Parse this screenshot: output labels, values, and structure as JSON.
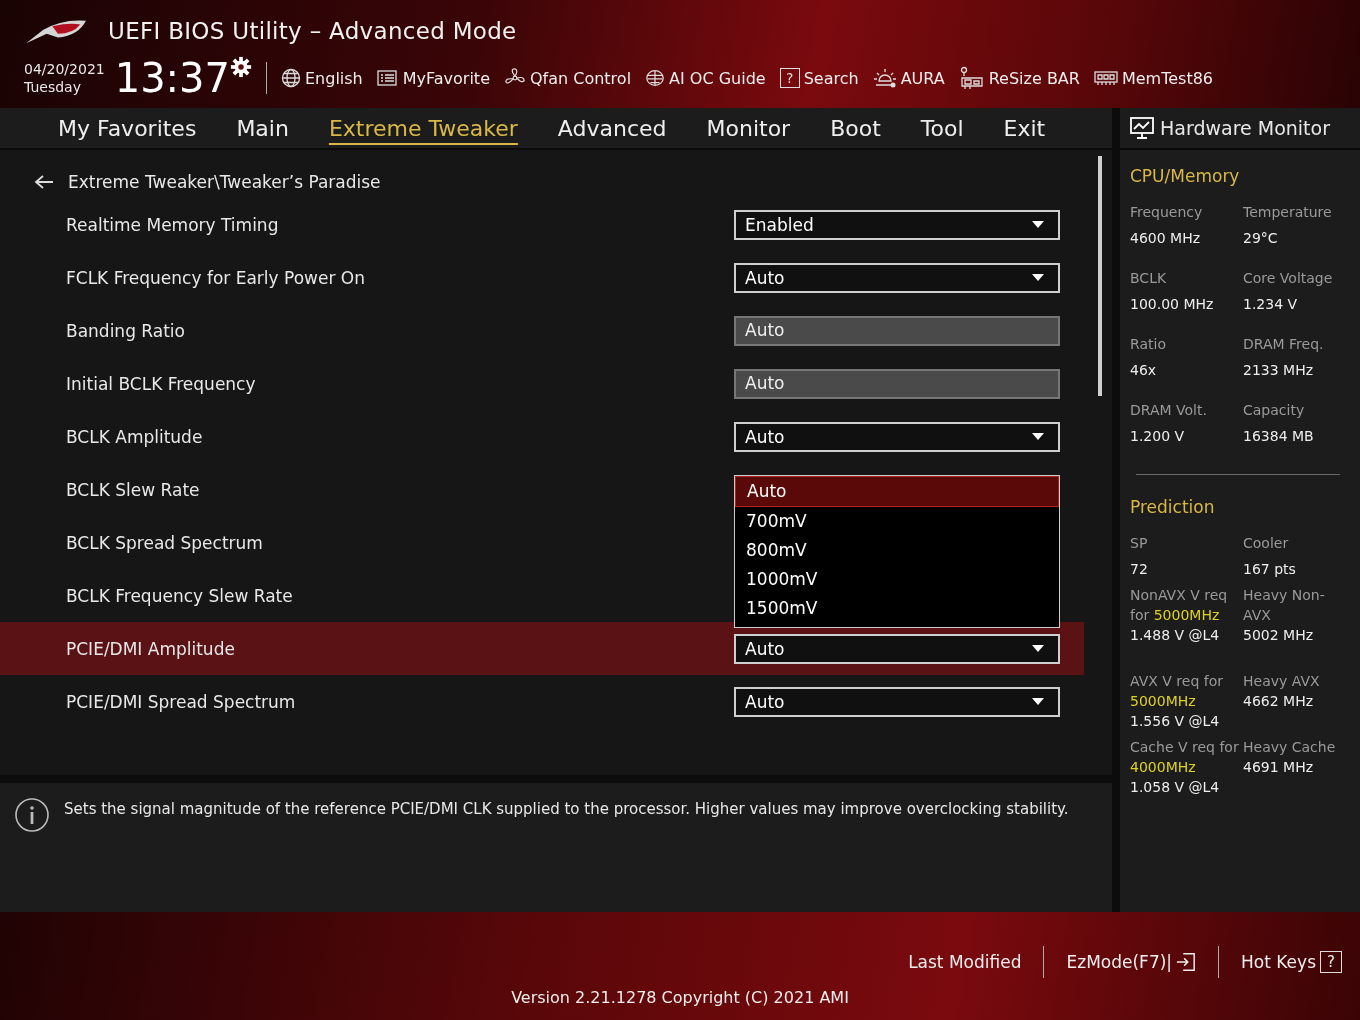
{
  "window": {
    "title": "UEFI BIOS Utility – Advanced Mode"
  },
  "header": {
    "date": "04/20/2021",
    "day": "Tuesday",
    "time": "13:37",
    "tools": [
      {
        "label": "English"
      },
      {
        "label": "MyFavorite"
      },
      {
        "label": "Qfan Control"
      },
      {
        "label": "AI OC Guide"
      },
      {
        "label": "Search",
        "glyph": "?"
      },
      {
        "label": "AURA"
      },
      {
        "label": "ReSize BAR"
      },
      {
        "label": "MemTest86"
      }
    ]
  },
  "tabs": [
    {
      "label": "My Favorites",
      "selected": false
    },
    {
      "label": "Main",
      "selected": false
    },
    {
      "label": "Extreme Tweaker",
      "selected": true
    },
    {
      "label": "Advanced",
      "selected": false
    },
    {
      "label": "Monitor",
      "selected": false
    },
    {
      "label": "Boot",
      "selected": false
    },
    {
      "label": "Tool",
      "selected": false
    },
    {
      "label": "Exit",
      "selected": false
    }
  ],
  "breadcrumb": "Extreme Tweaker\\Tweaker’s Paradise",
  "settings": [
    {
      "label": "Realtime Memory Timing",
      "kind": "dropdown",
      "value": "Enabled",
      "selected": false
    },
    {
      "label": "FCLK Frequency for Early Power On",
      "kind": "dropdown",
      "value": "Auto",
      "selected": false
    },
    {
      "label": "Banding Ratio",
      "kind": "readonly",
      "value": "Auto",
      "selected": false
    },
    {
      "label": "Initial BCLK Frequency",
      "kind": "readonly",
      "value": "Auto",
      "selected": false
    },
    {
      "label": "BCLK Amplitude",
      "kind": "dropdown",
      "value": "Auto",
      "selected": false
    },
    {
      "label": "BCLK Slew Rate",
      "kind": "open",
      "selected": false,
      "options": [
        {
          "label": "Auto",
          "selected": true
        },
        {
          "label": "700mV",
          "selected": false
        },
        {
          "label": "800mV",
          "selected": false
        },
        {
          "label": "1000mV",
          "selected": false
        },
        {
          "label": "1500mV",
          "selected": false
        }
      ]
    },
    {
      "label": "BCLK Spread Spectrum",
      "kind": "covered",
      "selected": false
    },
    {
      "label": "BCLK Frequency Slew Rate",
      "kind": "covered",
      "selected": false
    },
    {
      "label": "PCIE/DMI Amplitude",
      "kind": "dropdown",
      "value": "Auto",
      "selected": true
    },
    {
      "label": "PCIE/DMI Spread Spectrum",
      "kind": "dropdown",
      "value": "Auto",
      "selected": false
    }
  ],
  "help": "Sets the signal magnitude of the reference PCIE/DMI CLK supplied to the processor. Higher values may improve overclocking stability.",
  "hardware_monitor": {
    "title": "Hardware Monitor",
    "sections": [
      {
        "title": "CPU/Memory",
        "items": [
          {
            "label": "Frequency",
            "value": "4600 MHz"
          },
          {
            "label": "Temperature",
            "value": "29°C"
          },
          {
            "label": "BCLK",
            "value": "100.00 MHz"
          },
          {
            "label": "Core Voltage",
            "value": "1.234 V"
          },
          {
            "label": "Ratio",
            "value": "46x"
          },
          {
            "label": "DRAM Freq.",
            "value": "2133 MHz"
          },
          {
            "label": "DRAM Volt.",
            "value": "1.200 V"
          },
          {
            "label": "Capacity",
            "value": "16384 MB"
          }
        ]
      },
      {
        "title": "Prediction",
        "items": [
          {
            "label": "SP",
            "value": "72"
          },
          {
            "label": "Cooler",
            "value": "167 pts"
          }
        ],
        "requirements": [
          {
            "label": "NonAVX V req for",
            "freq": "5000MHz",
            "value": "1.488 V @L4",
            "heavy_label": "Heavy Non-AVX",
            "heavy_value": "5002 MHz"
          },
          {
            "label": "AVX V req for",
            "freq": "5000MHz",
            "value": "1.556 V @L4",
            "heavy_label": "Heavy AVX",
            "heavy_value": "4662 MHz"
          },
          {
            "label": "Cache V req for",
            "freq": "4000MHz",
            "value": "1.058 V @L4",
            "heavy_label": "Heavy Cache",
            "heavy_value": "4691 MHz"
          }
        ]
      }
    ]
  },
  "footer": {
    "buttons": [
      {
        "label": "Last Modified"
      },
      {
        "label": "EzMode(F7)|"
      },
      {
        "label": "Hot Keys",
        "glyph": "?"
      }
    ],
    "version": "Version 2.21.1278 Copyright (C) 2021 AMI"
  }
}
